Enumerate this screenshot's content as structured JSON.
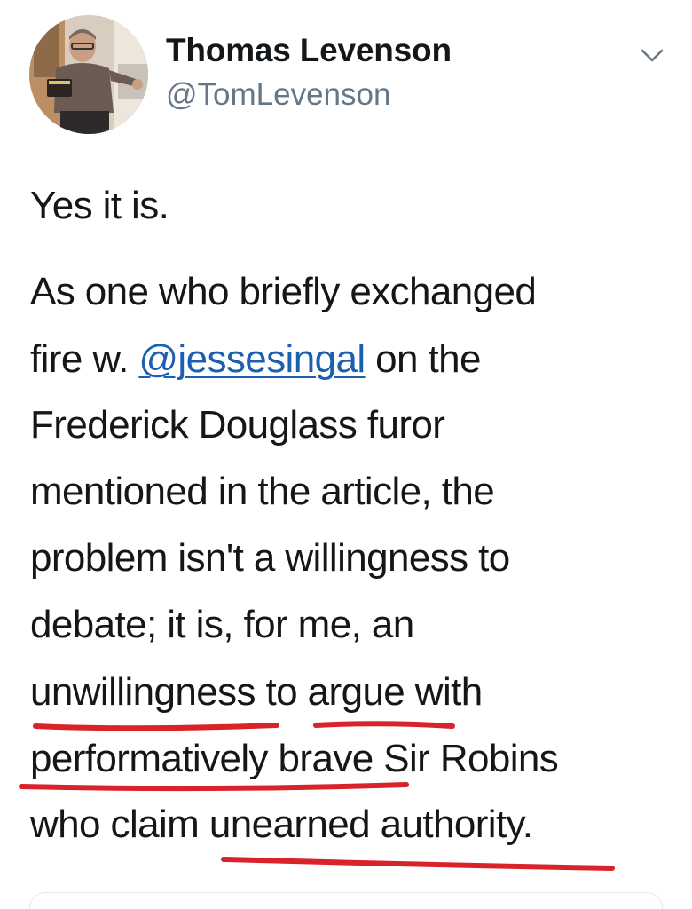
{
  "tweet": {
    "author": {
      "display_name": "Thomas Levenson",
      "handle": "@TomLevenson",
      "avatar_icon": "profile-photo"
    },
    "menu_icon": "chevron-down-icon",
    "paragraph_1": "Yes it is.",
    "paragraph_2_lines": {
      "l1": "As one who briefly exchanged",
      "l2_pre": "fire w. ",
      "l2_mention": "@jessesingal",
      "l2_post": " on the",
      "l3": "Frederick Douglass furor",
      "l4": "mentioned in the article, the",
      "l5": "problem isn't a willingness to",
      "l6": "debate; it is, for me, an",
      "l7": "unwillingness to argue with",
      "l8": "performatively brave Sir Robins",
      "l9": "who claim unearned authority."
    },
    "annotation_color": "#d8232a",
    "mention_color": "#1b5fb0"
  }
}
